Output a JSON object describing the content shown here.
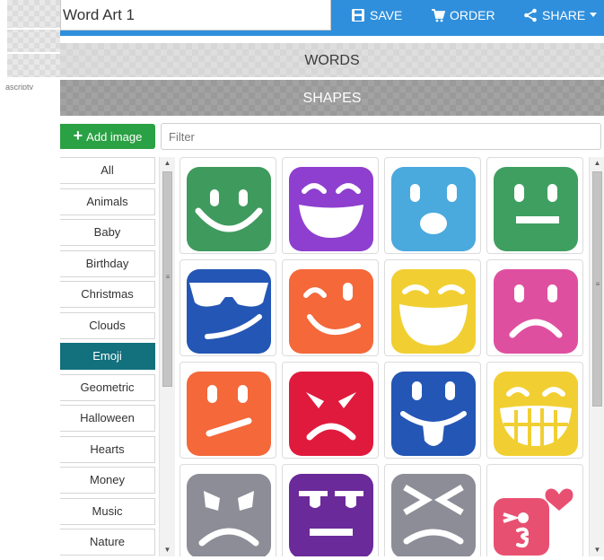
{
  "header": {
    "title_value": "Word Art 1",
    "save_label": "SAVE",
    "order_label": "ORDER",
    "share_label": "SHARE",
    "bar_color": "#2f8fdc"
  },
  "left_fragment": {
    "text": "ascripty"
  },
  "sections": {
    "words": "WORDS",
    "shapes": "SHAPES"
  },
  "toolbar": {
    "add_image_label": "Add image",
    "filter_placeholder": "Filter",
    "add_color": "#2aa144"
  },
  "categories": {
    "items": [
      "All",
      "Animals",
      "Baby",
      "Birthday",
      "Christmas",
      "Clouds",
      "Emoji",
      "Geometric",
      "Halloween",
      "Hearts",
      "Money",
      "Music",
      "Nature"
    ],
    "active": "Emoji",
    "active_color": "#13707d"
  },
  "emoji_tiles": [
    {
      "icon": "smile-emoji-icon",
      "color": "#3f9a5e"
    },
    {
      "icon": "grin-emoji-icon",
      "color": "#8e3fcf"
    },
    {
      "icon": "surprised-emoji-icon",
      "color": "#4aa9dd"
    },
    {
      "icon": "neutral-emoji-icon",
      "color": "#3f9f60"
    },
    {
      "icon": "sunglasses-emoji-icon",
      "color": "#2456b5"
    },
    {
      "icon": "wink-emoji-icon",
      "color": "#f4683a"
    },
    {
      "icon": "laugh-emoji-icon",
      "color": "#f1cf32"
    },
    {
      "icon": "sad-emoji-icon",
      "color": "#df4fa0"
    },
    {
      "icon": "skeptical-emoji-icon",
      "color": "#f4683a"
    },
    {
      "icon": "angry-emoji-icon",
      "color": "#e01a3d"
    },
    {
      "icon": "tongue-emoji-icon",
      "color": "#2456b5"
    },
    {
      "icon": "teeth-grin-emoji-icon",
      "color": "#f1cf32"
    },
    {
      "icon": "worried-emoji-icon",
      "color": "#8d8d98"
    },
    {
      "icon": "unamused-emoji-icon",
      "color": "#6a2a9a"
    },
    {
      "icon": "squint-emoji-icon",
      "color": "#8d8d98"
    },
    {
      "icon": "kiss-heart-emoji-icon",
      "color": "#e85071"
    }
  ]
}
